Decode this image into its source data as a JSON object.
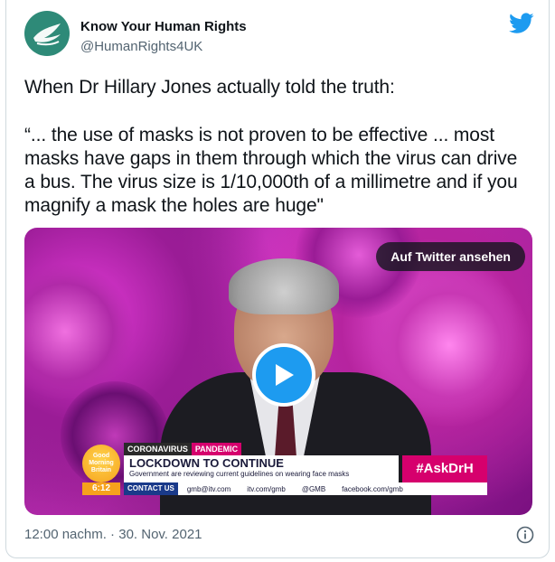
{
  "author": {
    "name": "Know Your Human Rights",
    "handle": "@HumanRights4UK"
  },
  "tweet": {
    "line1": "When Dr Hillary Jones actually told the truth:",
    "quote": "“... the use of masks is not proven to be effective ... most masks have gaps in them through which the virus can drive a bus. The virus size is 1/10,000th of a millimetre and if you magnify a mask the holes are huge\""
  },
  "video": {
    "watch_label": "Auf Twitter ansehen",
    "tv": {
      "logo_text": "Good Morning Britain",
      "time": "6:12",
      "tag_coronavirus": "CORONAVIRUS",
      "tag_pandemic": "PANDEMIC",
      "headline": "LOCKDOWN TO CONTINUE",
      "subheadline": "Government are reviewing current guidelines on wearing face masks",
      "hashtag": "#AskDrH",
      "contact_label": "CONTACT US",
      "email": "gmb@itv.com",
      "web": "itv.com/gmb",
      "twitter": "@GMB",
      "facebook": "facebook.com/gmb"
    }
  },
  "footer": {
    "timestamp": "12:00 nachm. · 30. Nov. 2021"
  },
  "colors": {
    "twitter_blue": "#1d9bf0",
    "avatar_bg": "#2e8a78",
    "text_secondary": "#536471"
  },
  "icons": [
    "avatar-dove-logo",
    "twitter-bird-icon",
    "play-icon",
    "info-icon"
  ]
}
